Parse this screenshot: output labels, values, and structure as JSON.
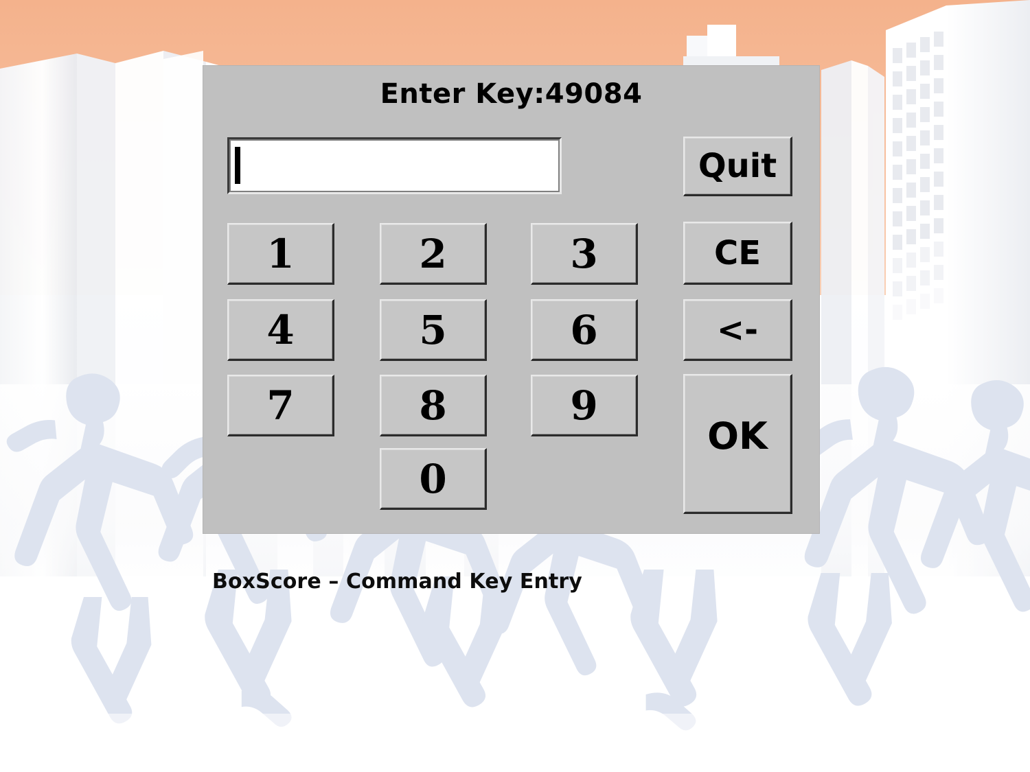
{
  "background": {
    "sky_color_top": "#f4b28c",
    "sky_color_bottom": "#fbd6bd",
    "building_color": "#ffffff",
    "runner_color": "#dde3ef",
    "scene": "city-skyline-with-runners"
  },
  "dialog": {
    "title": "Enter Key:49084",
    "face_color": "#c0c0c0",
    "entry": {
      "value": "",
      "placeholder": "",
      "caret_visible": true
    },
    "keypad": {
      "rows": [
        [
          "1",
          "2",
          "3"
        ],
        [
          "4",
          "5",
          "6"
        ],
        [
          "7",
          "8",
          "9"
        ],
        [
          "0"
        ]
      ],
      "keys": {
        "one": "1",
        "two": "2",
        "three": "3",
        "four": "4",
        "five": "5",
        "six": "6",
        "seven": "7",
        "eight": "8",
        "nine": "9",
        "zero": "0"
      }
    },
    "commands": {
      "quit": "Quit",
      "clear_entry": "CE",
      "backspace": "<-",
      "ok": "OK"
    }
  },
  "caption": {
    "text": "BoxScore – Command Key Entry"
  }
}
